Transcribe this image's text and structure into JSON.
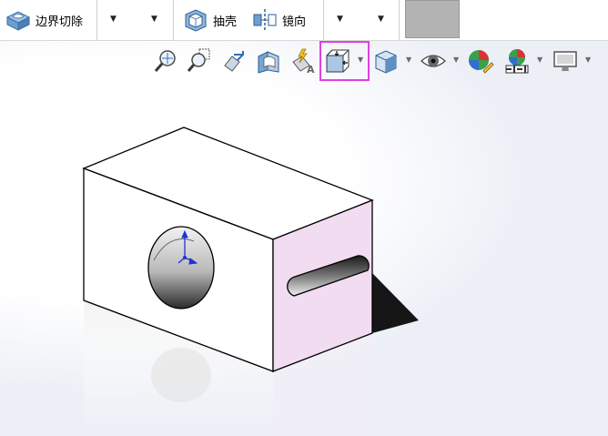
{
  "ribbon": {
    "boundary_cut": {
      "label": "边界切除",
      "icon": "boundary-cut-icon"
    },
    "shell": {
      "label": "抽壳",
      "icon": "shell-icon"
    },
    "mirror": {
      "label": "镜向",
      "icon": "mirror-icon"
    },
    "dropdown_glyph": "▼",
    "swatch_color": "#b3b3b3"
  },
  "view_toolbar": {
    "items": [
      {
        "name": "zoom-to-fit-icon"
      },
      {
        "name": "zoom-to-area-icon"
      },
      {
        "name": "previous-view-icon"
      },
      {
        "name": "section-view-icon"
      },
      {
        "name": "dynamic-annotation-views-icon"
      },
      {
        "name": "view-orientation-icon",
        "active": true
      },
      {
        "name": "display-style-icon"
      },
      {
        "name": "hide-show-items-icon"
      },
      {
        "name": "edit-appearance-icon"
      },
      {
        "name": "apply-scene-icon"
      },
      {
        "name": "view-settings-icon"
      }
    ],
    "highlight_color": "#e040e0",
    "dropdown_glyph": "▼"
  },
  "model": {
    "face_color": "#ffffff",
    "selected_face_color": "#f2dcf2",
    "edge_color": "#000000",
    "triad_color": "#1a33d9"
  }
}
